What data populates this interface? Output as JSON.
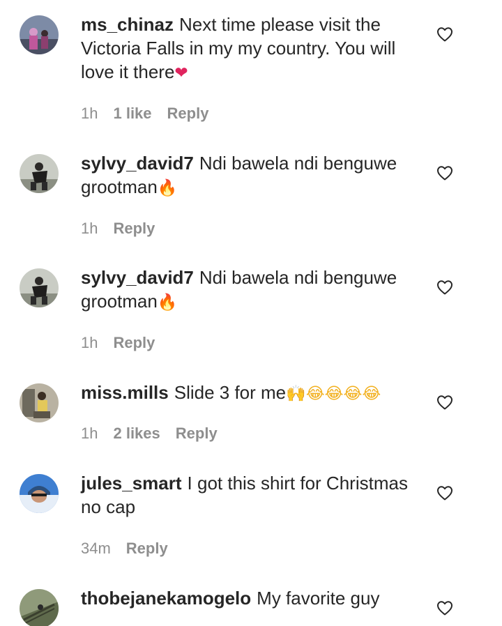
{
  "comments": [
    {
      "username": "ms_chinaz",
      "text": "Next time please visit the Victoria Falls in my my country. You will love it there",
      "emoji": "❤",
      "time": "1h",
      "likes": "1 like",
      "reply": "Reply",
      "avatar_icon": "profile-avatar"
    },
    {
      "username": "sylvy_david7",
      "text": "Ndi bawela ndi benguwe grootman",
      "emoji": "🔥",
      "time": "1h",
      "likes": "",
      "reply": "Reply",
      "avatar_icon": "profile-avatar"
    },
    {
      "username": "sylvy_david7",
      "text": "Ndi bawela ndi benguwe grootman",
      "emoji": "🔥",
      "time": "1h",
      "likes": "",
      "reply": "Reply",
      "avatar_icon": "profile-avatar"
    },
    {
      "username": "miss.mills",
      "text": "Slide 3 for me",
      "emoji": "🙌😂😂😂😂",
      "time": "1h",
      "likes": "2 likes",
      "reply": "Reply",
      "avatar_icon": "profile-avatar"
    },
    {
      "username": "jules_smart",
      "text": "I got this shirt for Christmas no cap",
      "emoji": "",
      "time": "34m",
      "likes": "",
      "reply": "Reply",
      "avatar_icon": "profile-avatar"
    },
    {
      "username": "thobejanekamogelo",
      "text": "My favorite guy",
      "emoji": "",
      "time": "",
      "likes": "",
      "reply": "",
      "avatar_icon": "profile-avatar"
    }
  ],
  "icons": {
    "like": "heart-outline-icon"
  },
  "colors": {
    "text": "#262626",
    "meta": "#8e8e8e",
    "heart_stroke": "#262626"
  }
}
